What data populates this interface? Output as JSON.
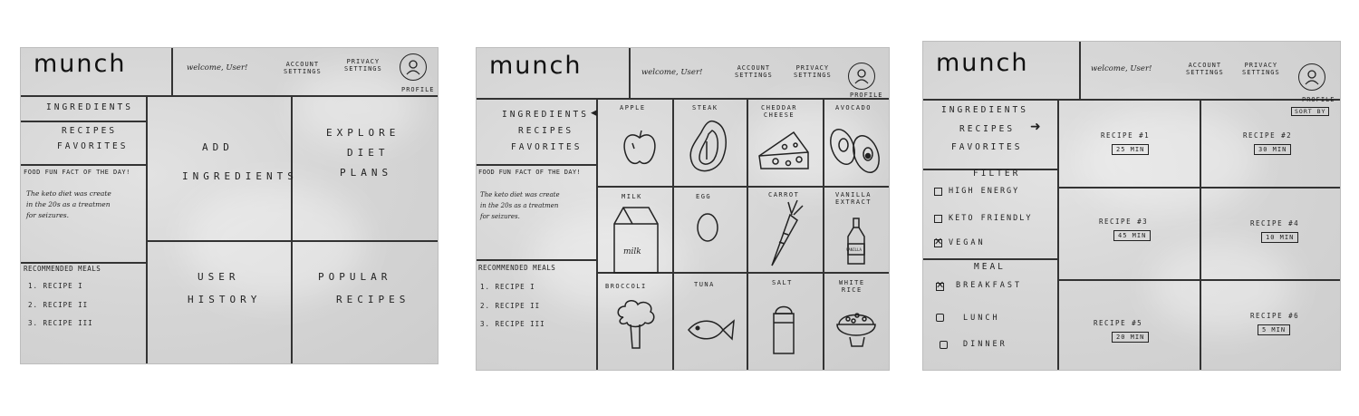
{
  "brand": "munch",
  "welcome": "welcome, User!",
  "account_settings": "ACCOUNT\nSETTINGS",
  "privacy_settings": "PRIVACY\nSETTINGS",
  "profile_label": "PROFILE",
  "sidebar_nav": {
    "ingredients": "INGREDIENTS",
    "recipes": "RECIPES",
    "favorites": "FAVORITES"
  },
  "fun_fact": {
    "heading": "FOOD FUN FACT OF THE DAY!",
    "line1": "The keto diet was create",
    "line2": "in the 20s as a treatmen",
    "line3": "for seizures."
  },
  "recommended": {
    "heading": "RECOMMENDED MEALS",
    "items": [
      "1. RECIPE I",
      "2. RECIPE II",
      "3. RECIPE III"
    ]
  },
  "home_tiles": {
    "add_ingredients_1": "ADD",
    "add_ingredients_2": "INGREDIENTS",
    "explore_1": "EXPLORE",
    "explore_2": "DIET",
    "explore_3": "PLANS",
    "user_history_1": "USER",
    "user_history_2": "HISTORY",
    "popular_1": "POPULAR",
    "popular_2": "RECIPES"
  },
  "ingredients_grid": [
    {
      "name": "APPLE",
      "icon": "apple-icon"
    },
    {
      "name": "STEAK",
      "icon": "steak-icon"
    },
    {
      "name": "CHEDDAR\nCHEESE",
      "icon": "cheese-icon"
    },
    {
      "name": "AVOCADO",
      "icon": "avocado-icon"
    },
    {
      "name": "MILK",
      "icon": "milk-icon"
    },
    {
      "name": "EGG",
      "icon": "egg-icon"
    },
    {
      "name": "CARROT",
      "icon": "carrot-icon"
    },
    {
      "name": "VANILLA\nEXTRACT",
      "icon": "vanilla-icon"
    },
    {
      "name": "BROCCOLI",
      "icon": "broccoli-icon"
    },
    {
      "name": "TUNA",
      "icon": "fish-icon"
    },
    {
      "name": "SALT",
      "icon": "salt-icon"
    },
    {
      "name": "WHITE\nRICE",
      "icon": "rice-icon"
    }
  ],
  "milk_carton_text": "milk",
  "vanilla_bottle_text": "VANILLA",
  "filter_panel": {
    "filter_heading": "FILTER",
    "high_energy": "HIGH ENERGY",
    "keto_friendly": "KETO FRIENDLY",
    "vegan": "VEGAN",
    "meal_heading": "MEAL",
    "breakfast": "BREAKFAST",
    "lunch": "LUNCH",
    "dinner": "DINNER"
  },
  "sort_by": "SORT BY",
  "recipes": [
    {
      "name": "RECIPE #1",
      "time": "25 MIN"
    },
    {
      "name": "RECIPE #2",
      "time": "30 MIN"
    },
    {
      "name": "RECIPE #3",
      "time": "45 MIN"
    },
    {
      "name": "RECIPE #4",
      "time": "10 MIN"
    },
    {
      "name": "RECIPE #5",
      "time": "20 MIN"
    },
    {
      "name": "RECIPE #6",
      "time": "5 MIN"
    }
  ],
  "checkbox_state": {
    "high_energy": false,
    "keto_friendly": false,
    "vegan": true,
    "breakfast": true,
    "lunch": false,
    "dinner": false
  }
}
